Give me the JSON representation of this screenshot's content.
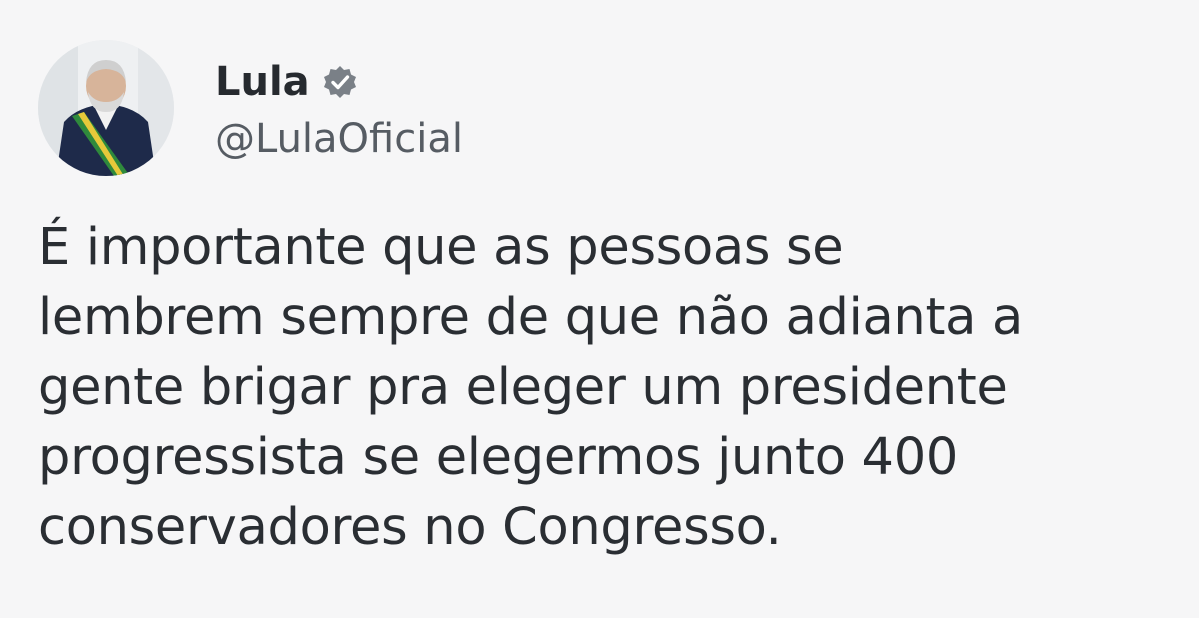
{
  "tweet": {
    "author": {
      "display_name": "Lula",
      "handle": "@LulaOficial",
      "verified": true,
      "avatar_icon": "profile-photo"
    },
    "text": "É importante que as pessoas se\nlembrem sempre de que não adianta a\ngente brigar pra eleger um presidente\nprogressista se elegermos junto 400\nconservadores no Congresso."
  },
  "colors": {
    "background": "#f6f6f7",
    "text": "#2a2e33",
    "handle": "#565c63",
    "verified_badge": "#7a8087"
  }
}
